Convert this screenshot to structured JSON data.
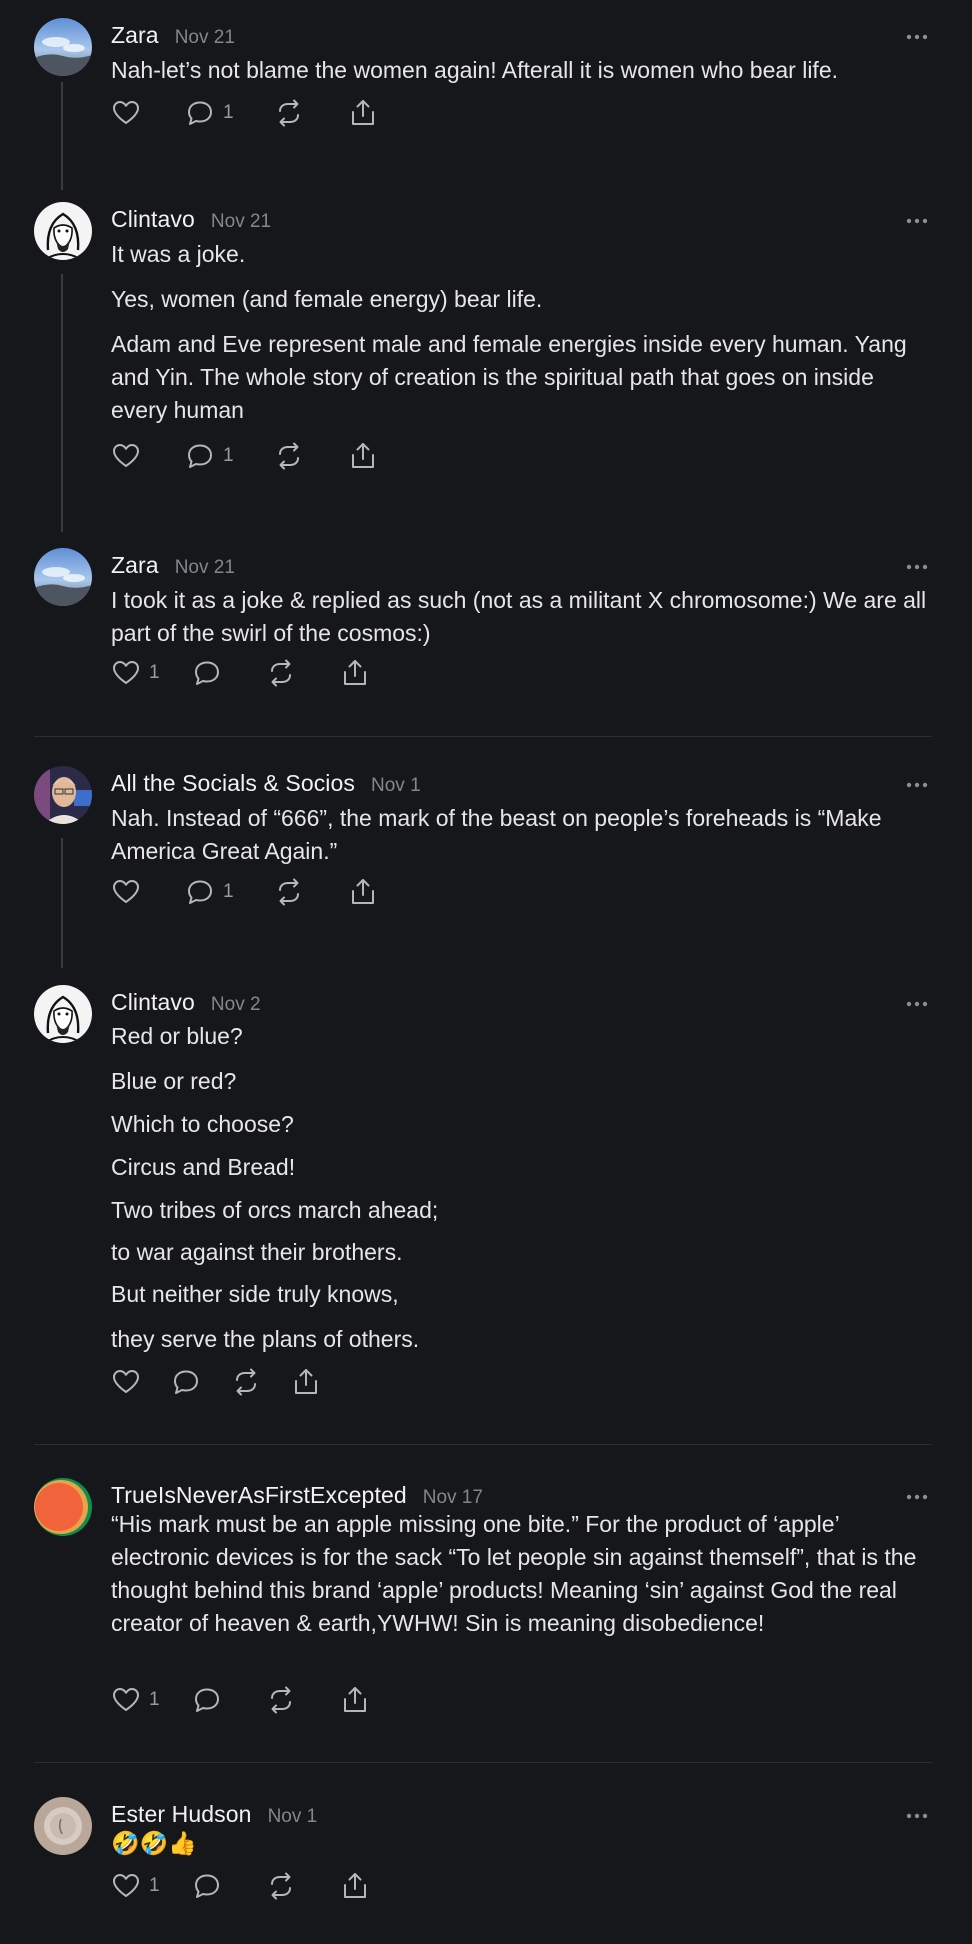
{
  "comments": [
    {
      "author": "Zara",
      "date": "Nov 21",
      "avatar": "avatar-sky",
      "paragraphs": [
        "Nah-let’s not blame the women again! Afterall it is women who bear life."
      ],
      "likes": "",
      "replies": "1"
    },
    {
      "author": "Clintavo",
      "date": "Nov 21",
      "avatar": "avatar-sketch",
      "paragraphs": [
        "It was a joke.",
        "Yes, women (and female energy) bear life.",
        "Adam and Eve represent male and female energies inside every human. Yang and Yin. The whole story of creation is the spiritual path that goes on inside every human"
      ],
      "likes": "",
      "replies": "1"
    },
    {
      "author": "Zara",
      "date": "Nov 21",
      "avatar": "avatar-sky",
      "paragraphs": [
        "I took it as a joke & replied as such (not as a militant X chromosome:) We are all part of the swirl of the cosmos:)"
      ],
      "likes": "1",
      "replies": ""
    },
    {
      "author": "All the Socials & Socios",
      "date": "Nov 1",
      "avatar": "avatar-photo",
      "paragraphs": [
        "Nah. Instead of “666”, the mark of the beast on people’s foreheads is “Make America Great Again.”"
      ],
      "likes": "",
      "replies": "1"
    },
    {
      "author": "Clintavo",
      "date": "Nov 2",
      "avatar": "avatar-sketch",
      "paragraphs": [
        "Red or blue?",
        "Blue or red?",
        "Which to choose?",
        "Circus and Bread!",
        "Two tribes of orcs march ahead;",
        "to war against their brothers.",
        "But neither side truly knows,",
        "they serve the plans of others."
      ],
      "likes": "",
      "replies": ""
    },
    {
      "author": "TrueIsNeverAsFirstExcepted",
      "date": "Nov 17",
      "avatar": "avatar-orange",
      "paragraphs": [
        "“His mark must be an apple missing one bite.” For the product of ‘apple’ electronic devices is for the sack “To let people sin against themself”, that is the thought behind this brand ‘apple’ products! Meaning ‘sin’ against God the real creator of heaven & earth,YWHW! Sin is meaning disobedience!"
      ],
      "likes": "1",
      "replies": ""
    },
    {
      "author": "Ester Hudson",
      "date": "Nov 1",
      "avatar": "avatar-beige",
      "paragraphs": [
        "🤣🤣👍"
      ],
      "likes": "1",
      "replies": ""
    }
  ],
  "colors": {
    "background": "#16171a",
    "text": "#e6e6e8",
    "muted": "#85868c",
    "icon": "#b5b6ba",
    "divider": "#2c2d31"
  },
  "icons": [
    "heart-icon",
    "comment-icon",
    "restack-icon",
    "share-icon",
    "more-icon"
  ]
}
